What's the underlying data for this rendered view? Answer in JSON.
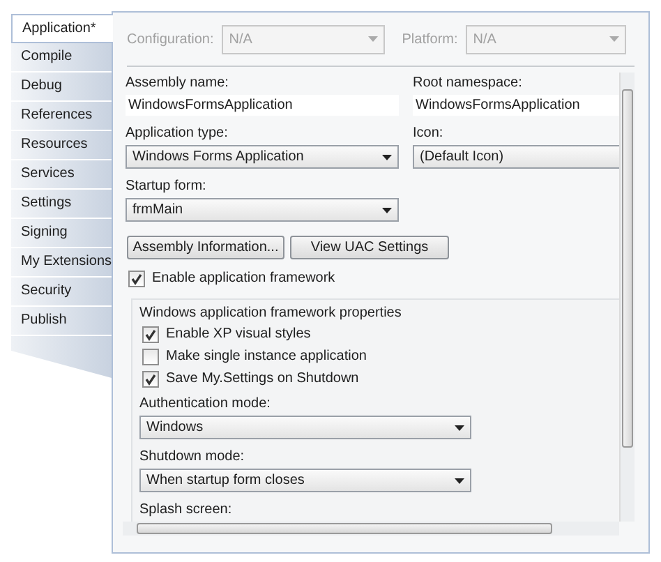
{
  "tabs": [
    {
      "label": "Application*",
      "selected": true
    },
    {
      "label": "Compile",
      "selected": false
    },
    {
      "label": "Debug",
      "selected": false
    },
    {
      "label": "References",
      "selected": false
    },
    {
      "label": "Resources",
      "selected": false
    },
    {
      "label": "Services",
      "selected": false
    },
    {
      "label": "Settings",
      "selected": false
    },
    {
      "label": "Signing",
      "selected": false
    },
    {
      "label": "My Extensions",
      "selected": false
    },
    {
      "label": "Security",
      "selected": false
    },
    {
      "label": "Publish",
      "selected": false
    }
  ],
  "configuration": {
    "label": "Configuration:",
    "value": "N/A",
    "disabled": true
  },
  "platform": {
    "label": "Platform:",
    "value": "N/A",
    "disabled": true
  },
  "assembly_name": {
    "label": "Assembly name:",
    "value": "WindowsFormsApplication"
  },
  "root_namespace": {
    "label": "Root namespace:",
    "value": "WindowsFormsApplication"
  },
  "application_type": {
    "label": "Application type:",
    "value": "Windows Forms Application"
  },
  "icon": {
    "label": "Icon:",
    "value": "(Default Icon)"
  },
  "startup_form": {
    "label": "Startup form:",
    "value": "frmMain"
  },
  "buttons": [
    "Assembly Information...",
    "View UAC Settings"
  ],
  "enable_framework": {
    "label": "Enable application framework",
    "checked": true
  },
  "framework_group": {
    "title": "Windows application framework properties",
    "options": [
      {
        "label": "Enable XP visual styles",
        "checked": true
      },
      {
        "label": "Make single instance application",
        "checked": false
      },
      {
        "label": "Save My.Settings on Shutdown",
        "checked": true
      }
    ],
    "authentication_mode": {
      "label": "Authentication mode:",
      "value": "Windows"
    },
    "shutdown_mode": {
      "label": "Shutdown mode:",
      "value": "When startup form closes"
    },
    "splash_screen": {
      "label": "Splash screen:"
    }
  }
}
